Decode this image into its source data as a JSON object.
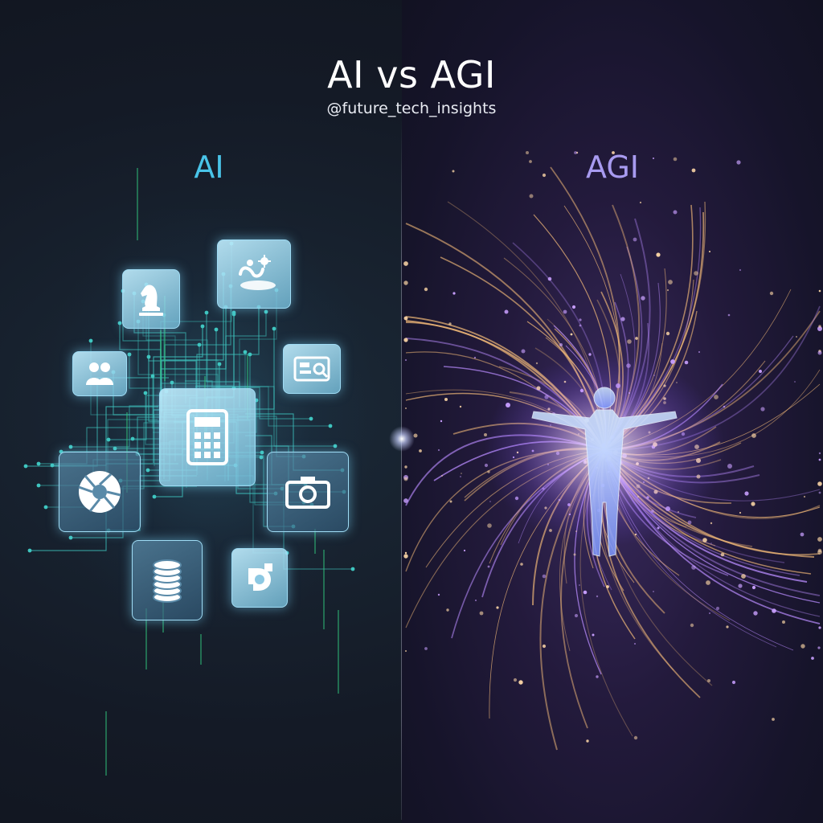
{
  "header": {
    "title": "AI vs AGI",
    "handle": "@future_tech_insights"
  },
  "left_panel": {
    "label": "AI",
    "accent_color": "#49c4e8",
    "icons": [
      "chess-knight-icon",
      "microscope-bacteria-icon",
      "people-icon",
      "id-card-icon",
      "calculator-icon",
      "camera-aperture-icon",
      "camera-icon",
      "coin-stack-icon",
      "gear-icon"
    ]
  },
  "right_panel": {
    "label": "AGI",
    "accent_color": "#a89bf0",
    "figure": "human-figure-icon"
  },
  "colors": {
    "background_left": "#141a26",
    "background_right": "#231a3c",
    "circuit": "#3fc6c0",
    "filament": "#f0b878",
    "particle": "#c9a0ff"
  }
}
